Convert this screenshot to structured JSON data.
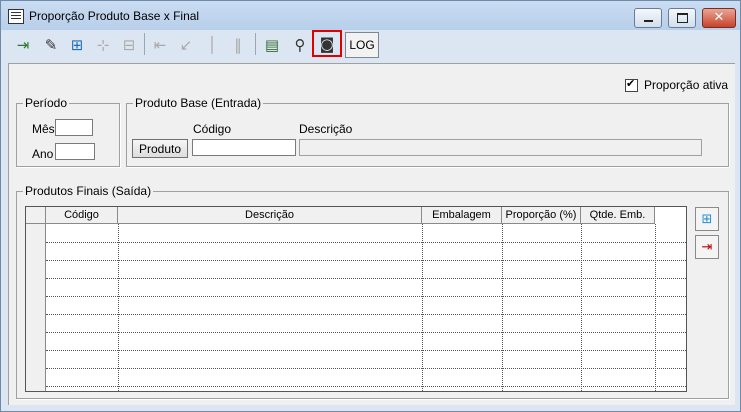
{
  "window": {
    "title": "Proporção Produto Base x Final"
  },
  "toolbar": {
    "log_label": "LOG",
    "icons": [
      "exit-icon",
      "edit-icon",
      "add-icon",
      "insert-disabled-icon",
      "remove-disabled-icon",
      "first-disabled-icon",
      "prev-disabled-icon",
      "next-disabled-icon",
      "last-disabled-icon",
      "list-icon",
      "search-icon",
      "camera-icon"
    ]
  },
  "proporcao_ativa": {
    "label": "Proporção ativa",
    "checked": true
  },
  "periodo": {
    "legend": "Período",
    "mes_label": "Mês",
    "ano_label": "Ano",
    "mes_value": "",
    "ano_value": ""
  },
  "produto_base": {
    "legend": "Produto Base (Entrada)",
    "codigo_label": "Código",
    "descricao_label": "Descrição",
    "button_label": "Produto",
    "codigo_value": "",
    "descricao_value": ""
  },
  "produtos_finais": {
    "legend": "Produtos Finais (Saída)",
    "columns": [
      "Código",
      "Descrição",
      "Embalagem",
      "Proporção (%)",
      "Qtde. Emb."
    ],
    "rows": 9
  },
  "colors": {
    "highlight": "#e00000",
    "close_button": "#c8422a"
  }
}
